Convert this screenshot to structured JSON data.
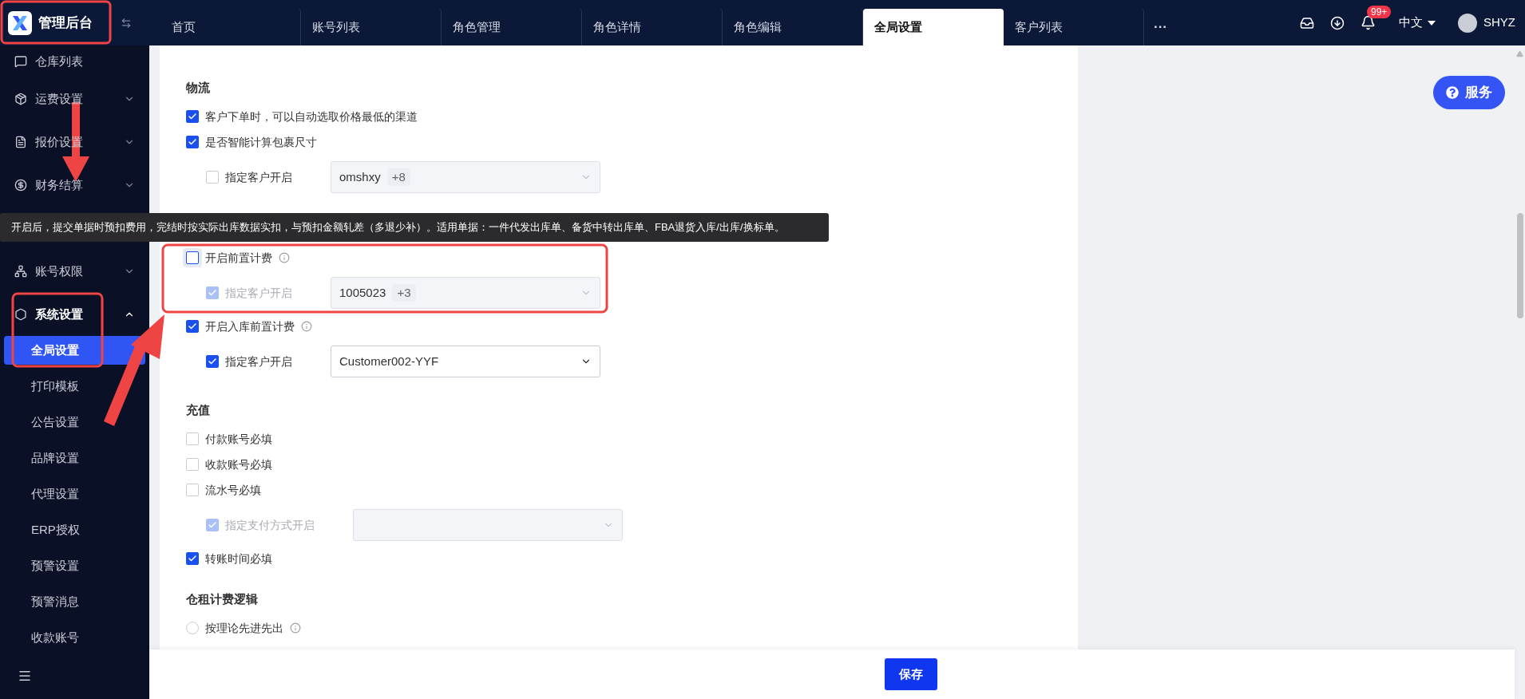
{
  "header": {
    "logo": "管理后台",
    "tabs": [
      {
        "label": "首页",
        "selected": false
      },
      {
        "label": "账号列表",
        "selected": false
      },
      {
        "label": "角色管理",
        "selected": false
      },
      {
        "label": "角色详情",
        "selected": false
      },
      {
        "label": "角色编辑",
        "selected": false
      },
      {
        "label": "全局设置",
        "selected": true
      },
      {
        "label": "客户列表",
        "selected": false
      }
    ],
    "more": "···",
    "badge": "99+",
    "language": "中文",
    "user": "SHYZ"
  },
  "sidebar": {
    "items": [
      {
        "label": "仓库列表"
      },
      {
        "label": "运费设置",
        "expanded": false
      },
      {
        "label": "报价设置",
        "expanded": false
      },
      {
        "label": "财务结算",
        "expanded": false
      },
      {
        "hidden": true
      },
      {
        "label": "账号权限",
        "expanded": false
      },
      {
        "label": "系统设置",
        "expanded": true,
        "children": [
          {
            "label": "全局设置",
            "selected": true
          },
          {
            "label": "打印模板",
            "selected": false
          },
          {
            "label": "公告设置",
            "selected": false
          },
          {
            "label": "品牌设置",
            "selected": false
          },
          {
            "label": "代理设置",
            "selected": false
          },
          {
            "label": "ERP授权",
            "selected": false
          },
          {
            "label": "预警设置",
            "selected": false
          },
          {
            "label": "预警消息",
            "selected": false
          },
          {
            "label": "收款账号",
            "selected": false
          }
        ]
      }
    ]
  },
  "tooltip": "开启后，提交单据时预扣费用，完结时按实际出库数据实扣，与预扣金额轧差（多退少补）。适用单据：一件代发出库单、备货中转出库单、FBA退货入库/出库/换标单。",
  "sections": [
    {
      "title": "物流",
      "rows": [
        {
          "kind": "checkbox",
          "label": "客户下单时，可以自动选取价格最低的渠道",
          "checked": true
        },
        {
          "kind": "checkbox",
          "label": "是否智能计算包裹尺寸",
          "checked": true,
          "children": [
            {
              "kind": "checkbox",
              "label": "指定客户开启",
              "checked": false,
              "disabled": false,
              "select": {
                "value": "omshxy",
                "extra": "+8",
                "disabled": true
              }
            }
          ]
        }
      ]
    },
    {
      "rows": [
        {
          "kind": "checkbox",
          "label": "开启前置计费",
          "checked": false,
          "focused": true,
          "info": true,
          "children": [
            {
              "kind": "checkbox",
              "label": "指定客户开启",
              "checked": true,
              "disabled": true,
              "select": {
                "value": "1005023",
                "extra": "+3",
                "disabled": true
              }
            }
          ]
        },
        {
          "kind": "checkbox",
          "label": "开启入库前置计费",
          "checked": true,
          "info": true,
          "children": [
            {
              "kind": "checkbox",
              "label": "指定客户开启",
              "checked": true,
              "disabled": false,
              "select": {
                "value": "Customer002-YYF",
                "disabled": false
              }
            }
          ]
        }
      ]
    },
    {
      "title": "充值",
      "rows": [
        {
          "kind": "checkbox",
          "label": "付款账号必填",
          "checked": false
        },
        {
          "kind": "checkbox",
          "label": "收款账号必填",
          "checked": false
        },
        {
          "kind": "checkbox",
          "label": "流水号必填",
          "checked": false,
          "children": [
            {
              "kind": "checkbox",
              "label": "指定支付方式开启",
              "checked": true,
              "disabled": true,
              "select": {
                "disabled": true
              }
            }
          ]
        },
        {
          "kind": "checkbox",
          "label": "转账时间必填",
          "checked": true
        }
      ]
    },
    {
      "title": "仓租计费逻辑",
      "rows": [
        {
          "kind": "radio",
          "label": "按理论先进先出",
          "checked": false,
          "info": true
        }
      ]
    }
  ],
  "service": "服务",
  "save": "保存"
}
